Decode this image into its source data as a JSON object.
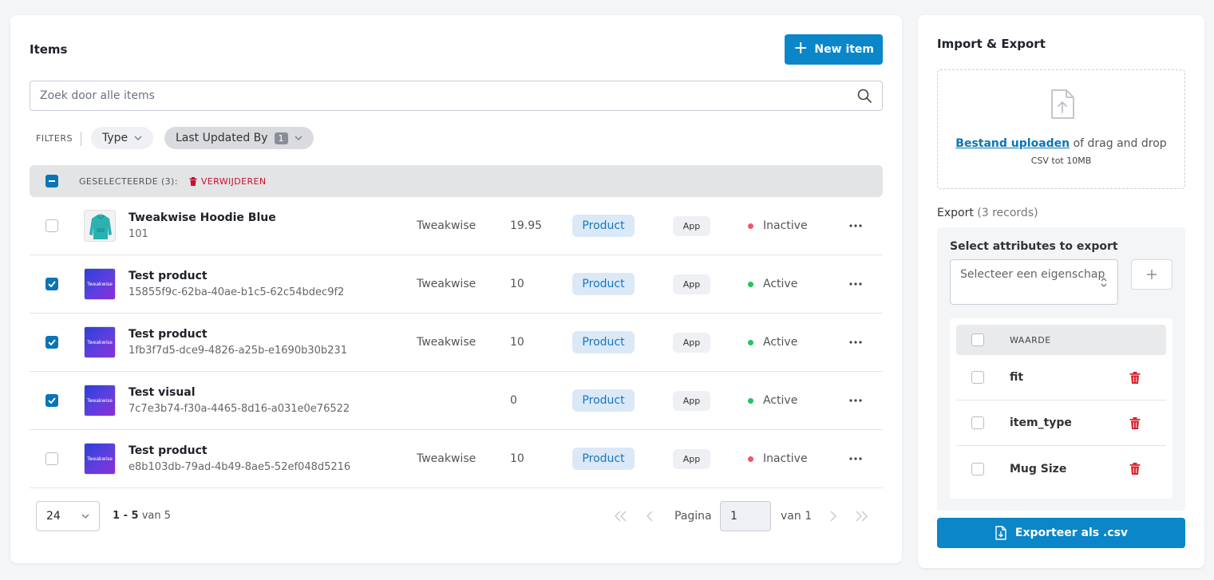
{
  "items": {
    "title": "Items",
    "new_item_label": "New item",
    "search_placeholder": "Zoek door alle items",
    "filters_label": "FILTERS",
    "filter_type_label": "Type",
    "filter_last_updated_label": "Last Updated By",
    "filter_last_updated_count": "1",
    "selected_label": "GESELECTEERDE (3):",
    "delete_label": "VERWIJDEREN",
    "rows": [
      {
        "name": "Tweakwise Hoodie Blue",
        "sub": "101",
        "brand": "Tweakwise",
        "price": "19.95",
        "type": "Product",
        "source": "App",
        "status": "Inactive",
        "checked": false,
        "thumb": "hoodie"
      },
      {
        "name": "Test product",
        "sub": "15855f9c-62ba-40ae-b1c5-62c54bdec9f2",
        "brand": "Tweakwise",
        "price": "10",
        "type": "Product",
        "source": "App",
        "status": "Active",
        "checked": true,
        "thumb": "logo"
      },
      {
        "name": "Test product",
        "sub": "1fb3f7d5-dce9-4826-a25b-e1690b30b231",
        "brand": "Tweakwise",
        "price": "10",
        "type": "Product",
        "source": "App",
        "status": "Active",
        "checked": true,
        "thumb": "logo"
      },
      {
        "name": "Test visual",
        "sub": "7c7e3b74-f30a-4465-8d16-a031e0e76522",
        "brand": "",
        "price": "0",
        "type": "Product",
        "source": "App",
        "status": "Active",
        "checked": true,
        "thumb": "logo"
      },
      {
        "name": "Test product",
        "sub": "e8b103db-79ad-4b49-8ae5-52ef048d5216",
        "brand": "Tweakwise",
        "price": "10",
        "type": "Product",
        "source": "App",
        "status": "Inactive",
        "checked": false,
        "thumb": "logo"
      }
    ],
    "thumb_logo_text": "Tweakwise",
    "pagination": {
      "page_size": "24",
      "range_prefix": "1 - 5",
      "range_suffix": "van 5",
      "page_label": "Pagina",
      "page_value": "1",
      "of_label": "van 1"
    }
  },
  "import_export": {
    "title": "Import & Export",
    "upload_link": "Bestand uploaden",
    "upload_rest": "of drag and drop",
    "upload_hint": "CSV tot 10MB",
    "export_label": "Export",
    "export_count": "(3 records)",
    "select_attr_label": "Select attributes to export",
    "select_placeholder": "Selecteer een eigenschap",
    "table_header": "WAARDE",
    "attributes": [
      "fit",
      "item_type",
      "Mug Size"
    ],
    "export_button": "Exporteer als .csv"
  },
  "colors": {
    "primary": "#0a86c9",
    "active": "#22c55e",
    "inactive": "#f0566b",
    "danger": "#d9232e"
  }
}
